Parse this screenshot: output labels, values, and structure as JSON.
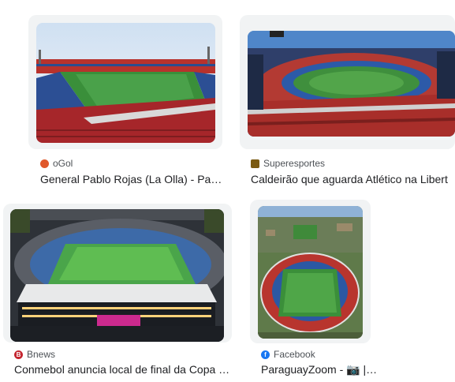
{
  "results": [
    {
      "source": "oGol",
      "source_icon": "ogol-favicon",
      "source_color": "#e0582b",
      "title": "General Pablo Rojas (La Olla) - Pa…"
    },
    {
      "source": "Superesportes",
      "source_icon": "superesportes-favicon",
      "source_color": "#7a5a12",
      "title": "Caldeirão que aguarda Atlético na Libert"
    },
    {
      "source": "Bnews",
      "source_icon": "bnews-favicon",
      "source_color": "#c4252f",
      "title": "Conmebol anuncia local de final da Copa …"
    },
    {
      "source": "Facebook",
      "source_icon": "facebook-favicon",
      "source_color": "#1877f2",
      "title": "ParaguayZoom - 📷 |…"
    }
  ]
}
